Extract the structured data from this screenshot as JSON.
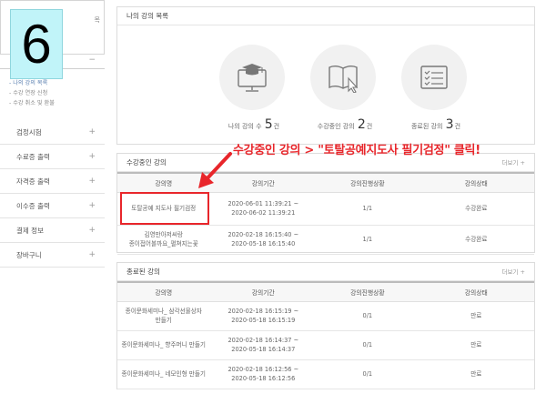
{
  "step_number": "6",
  "sidebar": {
    "top_text": "목",
    "section_toggle": "−",
    "sub_items": [
      "- 나의 강의 목록",
      "- 수강 연장 신청",
      "- 수강 취소 및 환불"
    ],
    "items": [
      {
        "label": "검정시험",
        "toggle": "+"
      },
      {
        "label": "수료증 출력",
        "toggle": "+"
      },
      {
        "label": "자격증 출력",
        "toggle": "+"
      },
      {
        "label": "이수증 출력",
        "toggle": "+"
      },
      {
        "label": "결제 정보",
        "toggle": "+"
      },
      {
        "label": "장바구니",
        "toggle": "+"
      }
    ]
  },
  "my_courses": {
    "title": "나의 강의 목록",
    "stats": [
      {
        "label": "나의 강의 수",
        "value": "5",
        "unit": "건"
      },
      {
        "label": "수강중인 강의",
        "value": "2",
        "unit": "건"
      },
      {
        "label": "종료된 강의",
        "value": "3",
        "unit": "건"
      }
    ]
  },
  "annotation": "수강중인 강의 > \"토탈공예지도사 필기검정\" 클릭!",
  "ongoing": {
    "title": "수강중인 강의",
    "more": "더보기 +",
    "headers": [
      "강의명",
      "강의기간",
      "강의진행상황",
      "강의상태"
    ],
    "rows": [
      {
        "name": "토탈공예 지도사 필기검정",
        "start": "2020-06-01 11:39:21 ~",
        "end": "2020-06-02 11:39:21",
        "progress": "1/1",
        "status": "수강완료"
      },
      {
        "name": "김영만아저씨랑\n종이접어볼까요_펼쳐지는꽃",
        "start": "2020-02-18 16:15:40 ~",
        "end": "2020-05-18 16:15:40",
        "progress": "1/1",
        "status": "수강완료"
      }
    ]
  },
  "finished": {
    "title": "종료된 강의",
    "more": "더보기 +",
    "headers": [
      "강의명",
      "강의기간",
      "강의진행상황",
      "강의상태"
    ],
    "rows": [
      {
        "name": "종이문화세미나_ 삼각선물상자\n만들기",
        "start": "2020-02-18 16:15:19 ~",
        "end": "2020-05-18 16:15:19",
        "progress": "0/1",
        "status": "만료"
      },
      {
        "name": "종이문화세미나_ 향주머니 만들기",
        "start": "2020-02-18 16:14:37 ~",
        "end": "2020-05-18 16:14:37",
        "progress": "0/1",
        "status": "만료"
      },
      {
        "name": "종이문화세미나_ 네모인형 만들기",
        "start": "2020-02-18 16:12:56 ~",
        "end": "2020-05-18 16:12:56",
        "progress": "0/1",
        "status": "만료"
      }
    ]
  },
  "colors": {
    "annotation": "#e8262b",
    "badge_bg": "#c1f4f9",
    "active_sub": "#5a7fb0"
  },
  "icons": [
    "monitor-graduation-cap-icon",
    "book-cursor-icon",
    "checklist-icon"
  ]
}
